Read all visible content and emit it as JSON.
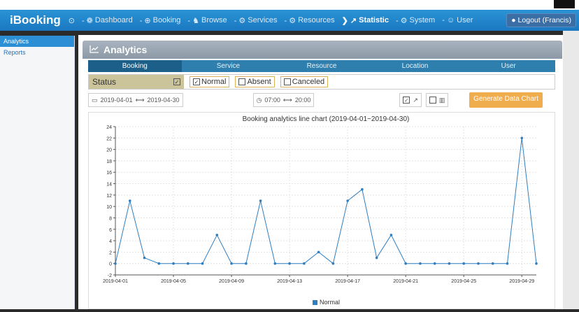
{
  "app": {
    "brand": "iBooking",
    "logout": "Logout (Francis)"
  },
  "nav": [
    {
      "icon": "⊙",
      "label": ""
    },
    {
      "icon": "- ❁",
      "label": "Dashboard"
    },
    {
      "icon": "- ⊕",
      "label": "Booking"
    },
    {
      "icon": "- ♞",
      "label": "Browse"
    },
    {
      "icon": "- ⚙",
      "label": "Services"
    },
    {
      "icon": "- ⚙",
      "label": "Resources"
    },
    {
      "icon": "❯ ↗",
      "label": "Statistic"
    },
    {
      "icon": "- ⚙",
      "label": "System"
    },
    {
      "icon": "- ☺",
      "label": "User"
    }
  ],
  "sidebar": {
    "items": [
      "Analytics",
      "Reports"
    ]
  },
  "panel": {
    "title": "Analytics"
  },
  "tabs": [
    "Booking",
    "Service",
    "Resource",
    "Location",
    "User"
  ],
  "filter": {
    "status": "Status",
    "normal": "Normal",
    "absent": "Absent",
    "canceled": "Canceled"
  },
  "toolbar": {
    "date_from": "2019-04-01",
    "date_to": "2019-04-30",
    "time_from": "07:00",
    "time_to": "20:00",
    "generate": "Generate Data Chart"
  },
  "chart_data": {
    "type": "line",
    "title": "Booking analytics line chart (2019-04-01~2019-04-30)",
    "x": [
      "2019-04-01",
      "2019-04-02",
      "2019-04-03",
      "2019-04-04",
      "2019-04-05",
      "2019-04-06",
      "2019-04-07",
      "2019-04-08",
      "2019-04-09",
      "2019-04-10",
      "2019-04-11",
      "2019-04-12",
      "2019-04-13",
      "2019-04-14",
      "2019-04-15",
      "2019-04-16",
      "2019-04-17",
      "2019-04-18",
      "2019-04-19",
      "2019-04-20",
      "2019-04-21",
      "2019-04-22",
      "2019-04-23",
      "2019-04-24",
      "2019-04-25",
      "2019-04-26",
      "2019-04-27",
      "2019-04-28",
      "2019-04-29",
      "2019-04-30"
    ],
    "tick_labels": [
      "2019-04-01",
      "2019-04-05",
      "2019-04-09",
      "2019-04-13",
      "2019-04-17",
      "2019-04-21",
      "2019-04-25",
      "2019-04-29"
    ],
    "series": [
      {
        "name": "Normal",
        "color": "#2f7ec0",
        "values": [
          0,
          11,
          1,
          0,
          0,
          0,
          0,
          5,
          0,
          0,
          11,
          0,
          0,
          0,
          2,
          0,
          11,
          13,
          1,
          5,
          0,
          0,
          0,
          0,
          0,
          0,
          0,
          0,
          22,
          0
        ]
      }
    ],
    "ylim": [
      -2,
      24
    ],
    "yticks": [
      -2,
      0,
      2,
      4,
      6,
      8,
      10,
      12,
      14,
      16,
      18,
      20,
      22,
      24
    ],
    "grid": true,
    "legend": "bottom"
  }
}
